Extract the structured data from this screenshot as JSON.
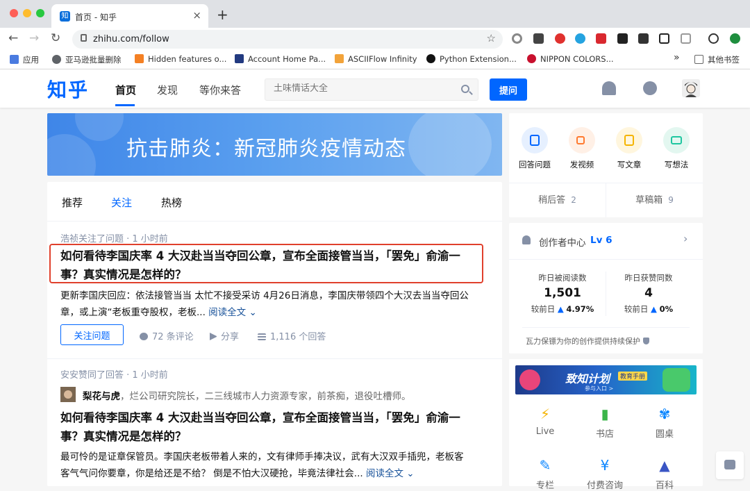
{
  "browser": {
    "tab_title": "首页 - 知乎",
    "tab_favicon": "知",
    "url": "zhihu.com/follow",
    "bookmarks": [
      {
        "label": "应用",
        "color": "#4a7be0"
      },
      {
        "label": "亚马逊批量删除",
        "color": "#5f6368"
      },
      {
        "label": "Hidden features o...",
        "color": "#f48024"
      },
      {
        "label": "Account Home Pa...",
        "color": "#223a80"
      },
      {
        "label": "ASCIIFlow Infinity",
        "color": "#f2a33a"
      },
      {
        "label": "Python Extension...",
        "color": "#121212"
      },
      {
        "label": "NIPPON COLORS...",
        "color": "#c8102e"
      }
    ],
    "bookmarks_more": "»",
    "other_bookmarks": "其他书签",
    "extension_badges": {
      "ext3": "2",
      "ext5": "1"
    }
  },
  "header": {
    "logo": "知乎",
    "nav": [
      "首页",
      "发现",
      "等你来答"
    ],
    "search_placeholder": "土味情话大全",
    "ask_label": "提问"
  },
  "banner": {
    "text": "抗击肺炎：新冠肺炎疫情动态"
  },
  "feed": {
    "tabs": [
      "推荐",
      "关注",
      "热榜"
    ],
    "items": [
      {
        "meta": "浩祯关注了问题 · 1 小时前",
        "title_line1": "如何看待李国庆率 4 大汉赴当当夺回公章，宣布全面接管当当，「罢免」俞渝一",
        "title_line2": "事？真实情况是怎样的？",
        "excerpt_line1": "更新李国庆回应：依法接管当当 太忙不接受采访 4月26日消息，李国庆带领四个大汉去当当夺回公",
        "excerpt_line2": "章，或上演“老板重夺股权，老板...",
        "read_more": "阅读全文",
        "follow_label": "关注问题",
        "comments": "72 条评论",
        "share": "分享",
        "answers": "1,116 个回答"
      },
      {
        "meta": "安安赞同了回答 · 1 小时前",
        "author_name": "梨花与虎",
        "author_bio": "，烂公司研究院长，二三线城市人力资源专家，前茶痴，退役吐槽师。",
        "title_line1": "如何看待李国庆率 4 大汉赴当当夺回公章，宣布全面接管当当，「罢免」俞渝一",
        "title_line2": "事？真实情况是怎样的？",
        "excerpt_line1": "最可怜的是证章保管员。李国庆老板带着人来的，文有律师手捧决议，武有大汉双手插兜，老板客",
        "excerpt_line2": "客气气问你要章，你是给还是不给？ 倒是不怕大汉硬抢，毕竟法律社会...",
        "read_more": "阅读全文"
      }
    ]
  },
  "quick_actions": [
    {
      "label": "回答问题",
      "bg": "#e6f0ff",
      "fg": "#0066ff"
    },
    {
      "label": "发视频",
      "bg": "#fff0e6",
      "fg": "#ff7a2f"
    },
    {
      "label": "写文章",
      "bg": "#fff6de",
      "fg": "#f5b400"
    },
    {
      "label": "写想法",
      "bg": "#e3f7f0",
      "fg": "#1ec6a0"
    }
  ],
  "drafts": [
    {
      "label": "稍后答",
      "count": "2"
    },
    {
      "label": "草稿箱",
      "count": "9"
    }
  ],
  "creator": {
    "title": "创作者中心",
    "level": "Lv 6",
    "stats": [
      {
        "label": "昨日被阅读数",
        "value": "1,501",
        "cmp_prefix": "较前日",
        "cmp_value": "4.97%"
      },
      {
        "label": "昨日获赞同数",
        "value": "4",
        "cmp_prefix": "较前日",
        "cmp_value": "0%"
      }
    ],
    "note": "瓦力保镖为你的创作提供持续保护"
  },
  "promo": {
    "title": "致知计划",
    "tag": "教育手册",
    "sub": "参与入口 >"
  },
  "tiles": [
    {
      "label": "Live",
      "icon": "⚡",
      "color": "#f5b400"
    },
    {
      "label": "书店",
      "icon": "▮",
      "color": "#3bb54a"
    },
    {
      "label": "圆桌",
      "icon": "✾",
      "color": "#0a85ff"
    },
    {
      "label": "专栏",
      "icon": "✎",
      "color": "#0a85ff"
    },
    {
      "label": "付费咨询",
      "icon": "¥",
      "color": "#0a85ff"
    },
    {
      "label": "百科",
      "icon": "▲",
      "color": "#3a55c4"
    }
  ],
  "colors": {
    "brand": "#0066ff",
    "highlight": "#e0402c",
    "meta": "#8590a6"
  }
}
